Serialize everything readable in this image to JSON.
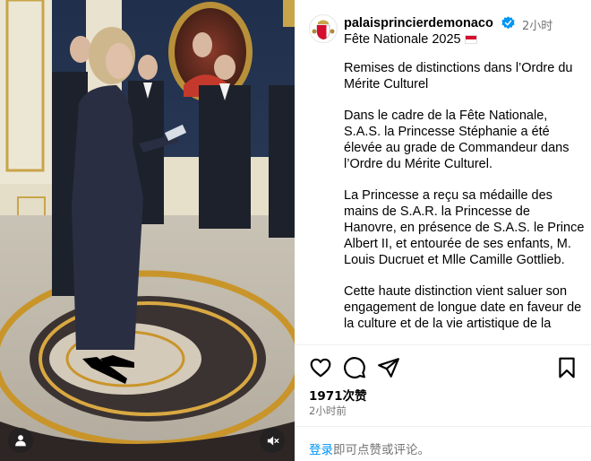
{
  "post": {
    "username": "palaisprincierdemonaco",
    "time_ago": "2小时",
    "caption_title": "Fête Nationale 2025",
    "caption_paragraphs": [
      "Remises de distinctions dans l’Ordre du Mérite Culturel",
      "Dans le cadre de la Fête Nationale, S.A.S. la Princesse Stéphanie a été élevée au grade de Commandeur dans l’Ordre du Mérite Culturel.",
      "La Princesse a reçu sa médaille des mains de S.A.R. la Princesse de Hanovre, en présence de S.A.S. le Prince Albert II, et entourée de ses enfants, M. Louis Ducruet et Mlle Camille Gottlieb.",
      "Cette haute distinction vient saluer son engagement de longue date en faveur de la culture et de la vie artistique de la"
    ]
  },
  "stats": {
    "likes": "1971次赞",
    "date": "2小时前"
  },
  "footer": {
    "login_link": "登录",
    "login_rest": "即可点赞或评论。"
  },
  "icons": {
    "like": "heart-icon",
    "comment": "comment-bubble-icon",
    "share": "paper-plane-icon",
    "save": "bookmark-icon",
    "user_tag": "person-icon",
    "mute": "speaker-muted-icon",
    "verified": "verified-badge-icon"
  },
  "colors": {
    "verified_blue": "#0095f6",
    "link_blue": "#0095f6",
    "muted_text": "#737373",
    "monaco_red": "#d50d2e"
  }
}
